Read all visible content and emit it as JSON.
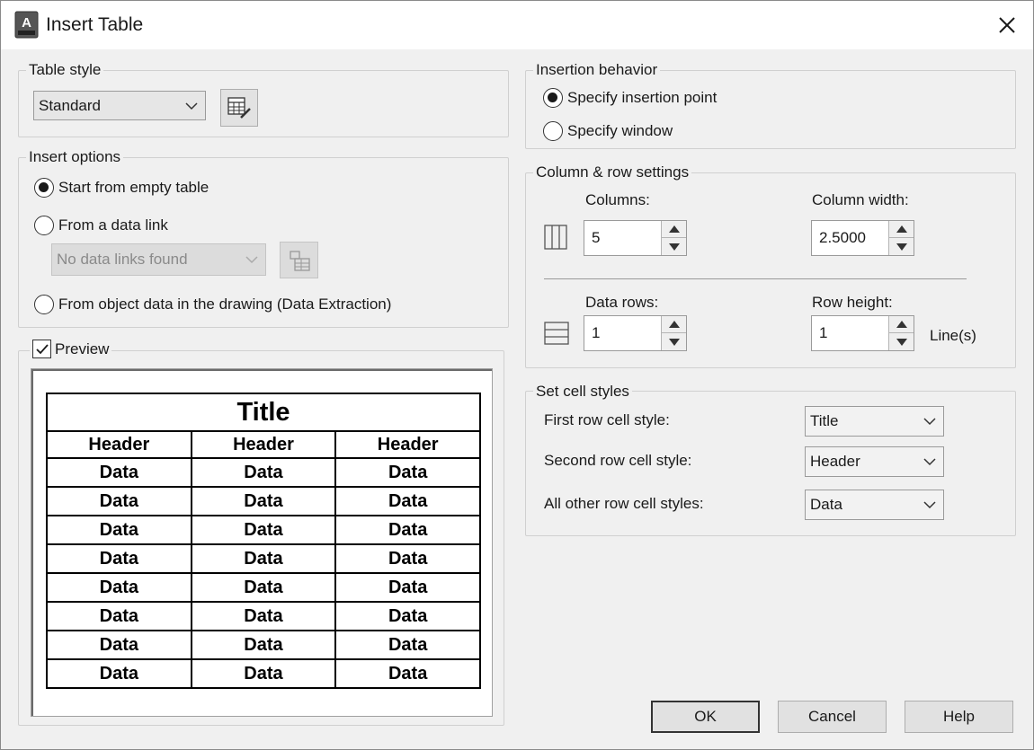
{
  "window": {
    "title": "Insert Table"
  },
  "table_style": {
    "group_label": "Table style",
    "selected": "Standard"
  },
  "insert_options": {
    "group_label": "Insert options",
    "start_empty": "Start from empty table",
    "from_data_link": "From a data link",
    "data_link_placeholder": "No data links found",
    "from_object_data": "From object data in the drawing (Data Extraction)"
  },
  "preview": {
    "label": "Preview",
    "checked": true,
    "table": {
      "title": "Title",
      "headers": [
        "Header",
        "Header",
        "Header"
      ],
      "rows": [
        [
          "Data",
          "Data",
          "Data"
        ],
        [
          "Data",
          "Data",
          "Data"
        ],
        [
          "Data",
          "Data",
          "Data"
        ],
        [
          "Data",
          "Data",
          "Data"
        ],
        [
          "Data",
          "Data",
          "Data"
        ],
        [
          "Data",
          "Data",
          "Data"
        ],
        [
          "Data",
          "Data",
          "Data"
        ],
        [
          "Data",
          "Data",
          "Data"
        ]
      ]
    }
  },
  "insertion_behavior": {
    "group_label": "Insertion behavior",
    "specify_point": "Specify insertion point",
    "specify_window": "Specify window"
  },
  "column_row": {
    "group_label": "Column & row settings",
    "columns_label": "Columns:",
    "columns_value": "5",
    "column_width_label": "Column width:",
    "column_width_value": "2.5000",
    "data_rows_label": "Data rows:",
    "data_rows_value": "1",
    "row_height_label": "Row height:",
    "row_height_value": "1",
    "row_height_unit": "Line(s)"
  },
  "cell_styles": {
    "group_label": "Set cell styles",
    "first_label": "First row cell style:",
    "first_value": "Title",
    "second_label": "Second row cell style:",
    "second_value": "Header",
    "other_label": "All other row cell styles:",
    "other_value": "Data"
  },
  "buttons": {
    "ok": "OK",
    "cancel": "Cancel",
    "help": "Help"
  }
}
